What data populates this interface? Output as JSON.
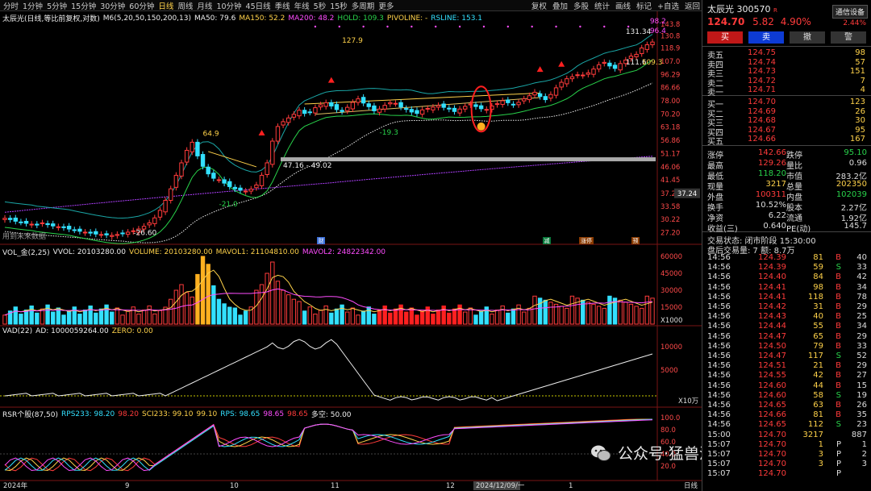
{
  "toolbar": {
    "timeframes": [
      "分时",
      "1分钟",
      "5分钟",
      "15分钟",
      "30分钟",
      "60分钟",
      "日线",
      "周线",
      "月线",
      "10分钟",
      "45日线",
      "季线",
      "年线",
      "5秒",
      "15秒",
      "多周期",
      "更多"
    ],
    "active": "日线",
    "tools": [
      "复权",
      "叠加",
      "多股",
      "统计",
      "画线",
      "标记",
      "+自选",
      "返回"
    ]
  },
  "main_header": {
    "stock": "太辰光(日线,等比前复权,对数)",
    "ma_label": "M6(5,20,50,150,200,13)",
    "ma50": "MA50: 79.6",
    "ma150": "MA150: 52.2",
    "ma200": "MA200: 48.2",
    "hold": "HOLD: 109.3",
    "pivoline": "PIVOLINE: -",
    "rsline": "RSLINE: 153.1"
  },
  "price_axis": [
    "143.8",
    "130.8",
    "118.9",
    "107.0",
    "96.29",
    "86.66",
    "78.00",
    "70.20",
    "63.18",
    "56.86",
    "51.17",
    "46.06",
    "41.45",
    "37.24",
    "33.58",
    "30.22",
    "27.20"
  ],
  "price_marker": "37.24",
  "annotations": {
    "high1": "127.9",
    "low1": "-19.3",
    "high2": "64.9",
    "low2": "-21.0",
    "range": "47.16 - 49.02",
    "low3": "-26.60",
    "top_a": "98.2",
    "top_b": "96.4",
    "peak": "131.34",
    "low4": "111.6",
    "low5": "109.3",
    "future": "用到未来数据",
    "b_events": [
      "财",
      "减",
      "涨停",
      "预"
    ]
  },
  "vol_header": {
    "label": "VOL_金(2,25)",
    "vvol": "VVOL: 20103280.00",
    "volume": "VOLUME: 20103280.00",
    "mavol1": "MAVOL1: 21104810.00",
    "mavol2": "MAVOL2: 24822342.00",
    "axis": [
      "60000",
      "45000",
      "30000",
      "15000",
      "X1000"
    ]
  },
  "vad_header": {
    "label": "VAD(22)",
    "ad": "AD: 1000059264.00",
    "zero": "ZERO: 0.00",
    "axis": [
      "10000",
      "5000",
      "X10万"
    ]
  },
  "rsr_header": {
    "label": "RSR个股(87,50)",
    "rps233": "RPS233: 98.20",
    "v1": "98.20",
    "sci233": "SCI233: 99.10",
    "v2": "99.10",
    "rps": "RPS: 98.65",
    "v3": "98.65",
    "v4": "98.65",
    "multi": "多空: 50.00",
    "axis": [
      "100.0",
      "80.0",
      "60.0",
      "40.0",
      "20.0"
    ]
  },
  "date_axis": {
    "labels": [
      "2024年",
      "9",
      "10",
      "11",
      "12",
      "2024/12/09/一",
      "1"
    ],
    "right": "日线"
  },
  "quote": {
    "name": "太辰光",
    "code": "300570",
    "badge": "R",
    "price": "124.70",
    "change": "5.82",
    "pct": "4.90%",
    "tag": "通信设备",
    "tag_pct": "2.44%"
  },
  "trade_buttons": [
    "买",
    "卖",
    "撤",
    "警"
  ],
  "asks": [
    {
      "l": "卖五",
      "p": "124.75",
      "v": "98"
    },
    {
      "l": "卖四",
      "p": "124.74",
      "v": "57"
    },
    {
      "l": "卖三",
      "p": "124.73",
      "v": "151"
    },
    {
      "l": "卖二",
      "p": "124.72",
      "v": "7"
    },
    {
      "l": "卖一",
      "p": "124.71",
      "v": "4"
    }
  ],
  "bids": [
    {
      "l": "买一",
      "p": "124.70",
      "v": "123"
    },
    {
      "l": "买二",
      "p": "124.69",
      "v": "26"
    },
    {
      "l": "买三",
      "p": "124.68",
      "v": "30"
    },
    {
      "l": "买四",
      "p": "124.67",
      "v": "95"
    },
    {
      "l": "买五",
      "p": "124.66",
      "v": "167"
    }
  ],
  "stats": [
    [
      "涨停",
      "142.66",
      "跌停",
      "95.10"
    ],
    [
      "最高",
      "129.26",
      "量比",
      "0.96"
    ],
    [
      "最低",
      "118.20",
      "市值",
      "283.2亿"
    ],
    [
      "现量",
      "3217",
      "总量",
      "202350"
    ],
    [
      "外盘",
      "100311",
      "内盘",
      "102039"
    ],
    [
      "换手",
      "10.52%",
      "股本",
      "2.27亿"
    ],
    [
      "净资",
      "6.22",
      "流通",
      "1.92亿"
    ],
    [
      "收益(三)",
      "0.640",
      "PE(动)",
      "145.7"
    ]
  ],
  "status": {
    "line1": "交易状态: 闭市阶段 15:30:00",
    "line2": "盘后交易量: 7  额: 8.7万"
  },
  "ticks": [
    [
      "14:56",
      "124.39",
      "81",
      "B",
      "40"
    ],
    [
      "14:56",
      "124.39",
      "59",
      "S",
      "33"
    ],
    [
      "14:56",
      "124.40",
      "84",
      "B",
      "42"
    ],
    [
      "14:56",
      "124.41",
      "98",
      "B",
      "34"
    ],
    [
      "14:56",
      "124.41",
      "118",
      "B",
      "78"
    ],
    [
      "14:56",
      "124.42",
      "31",
      "B",
      "29"
    ],
    [
      "14:56",
      "124.43",
      "40",
      "B",
      "25"
    ],
    [
      "14:56",
      "124.44",
      "55",
      "B",
      "34"
    ],
    [
      "14:56",
      "124.47",
      "65",
      "B",
      "29"
    ],
    [
      "14:56",
      "124.50",
      "79",
      "B",
      "33"
    ],
    [
      "14:56",
      "124.47",
      "117",
      "S",
      "52"
    ],
    [
      "14:56",
      "124.51",
      "21",
      "B",
      "29"
    ],
    [
      "14:56",
      "124.55",
      "42",
      "B",
      "27"
    ],
    [
      "14:56",
      "124.60",
      "44",
      "B",
      "15"
    ],
    [
      "14:56",
      "124.60",
      "58",
      "S",
      "19"
    ],
    [
      "14:56",
      "124.65",
      "63",
      "B",
      "26"
    ],
    [
      "14:56",
      "124.66",
      "81",
      "B",
      "35"
    ],
    [
      "14:56",
      "124.65",
      "112",
      "S",
      "23"
    ],
    [
      "15:00",
      "124.70",
      "3217",
      "",
      "887"
    ],
    [
      "15:07",
      "124.70",
      "1",
      "P",
      "1"
    ],
    [
      "15:07",
      "124.70",
      "3",
      "P",
      "2"
    ],
    [
      "15:07",
      "124.70",
      "3",
      "P",
      "3"
    ],
    [
      "15:07",
      "124.70",
      "",
      "P",
      ""
    ]
  ],
  "watermark": "公众号·猛兽派选股",
  "colors": {
    "up": "#ff3b3b",
    "down": "#33e0ff",
    "ma_white": "#eeeeee",
    "ma_purple": "#b040ff",
    "yellow": "#ffd24a",
    "green": "#29d34b",
    "cyan_band": "#1aa6a6"
  },
  "chart_data": {
    "type": "candlestick",
    "ylim": [
      26.6,
      143.8
    ],
    "scale": "log",
    "closes": [
      30.5,
      30.2,
      29.8,
      29.6,
      29.3,
      29.1,
      28.9,
      29.4,
      29.0,
      28.7,
      28.5,
      28.3,
      28.0,
      27.8,
      27.5,
      27.3,
      27.1,
      26.9,
      26.8,
      26.7,
      26.6,
      26.8,
      27.0,
      27.3,
      27.6,
      28.0,
      28.6,
      29.4,
      30.6,
      32.5,
      35.2,
      38.6,
      43.0,
      47.5,
      52.5,
      56.0,
      50.2,
      46.2,
      43.5,
      42.0,
      41.5,
      40.4,
      39.3,
      38.6,
      38.2,
      37.9,
      38.5,
      39.8,
      43.0,
      47.5,
      56.5,
      63.5,
      66.0,
      68.0,
      70.0,
      72.3,
      70.5,
      71.2,
      73.8,
      75.5,
      76.8,
      74.8,
      72.7,
      71.6,
      74.0,
      77.0,
      79.2,
      76.6,
      74.4,
      72.0,
      73.0,
      75.2,
      76.8,
      76.4,
      74.2,
      72.8,
      71.3,
      70.5,
      72.5,
      73.4,
      74.1,
      75.1,
      74.0,
      73.0,
      71.6,
      73.0,
      74.6,
      76.0,
      74.5,
      73.2,
      72.8,
      74.8,
      76.2,
      78.0,
      76.8,
      75.6,
      77.0,
      79.2,
      81.2,
      83.5,
      80.7,
      78.7,
      82.0,
      86.5,
      90.4,
      93.0,
      94.5,
      96.0,
      95.8,
      97.5,
      100.5,
      104.0,
      106.0,
      103.0,
      101.0,
      105.0,
      108.0,
      111.5,
      113.0,
      118.9,
      122.0,
      124.7
    ]
  }
}
